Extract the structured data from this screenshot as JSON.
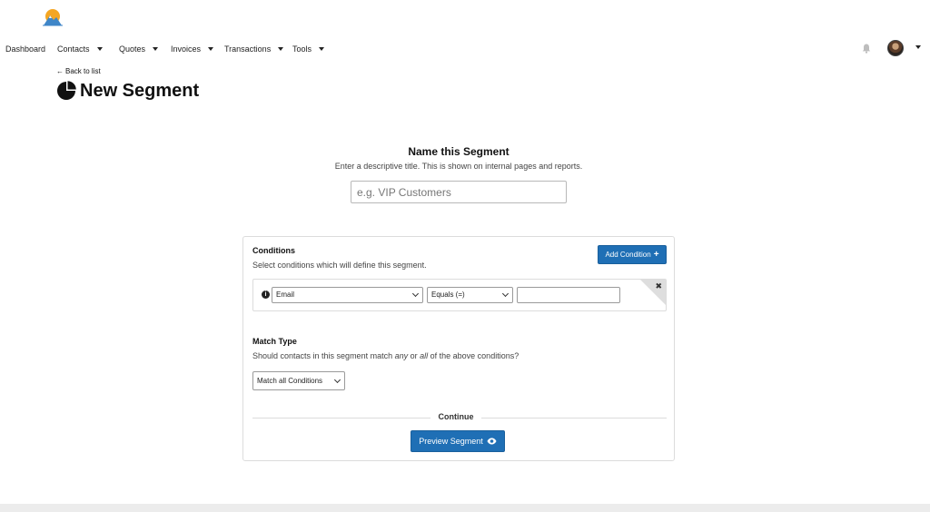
{
  "nav": {
    "items": [
      {
        "label": "Dashboard",
        "dropdown": false
      },
      {
        "label": "Contacts",
        "dropdown": true
      },
      {
        "label": "Quotes",
        "dropdown": true
      },
      {
        "label": "Invoices",
        "dropdown": true
      },
      {
        "label": "Transactions",
        "dropdown": true
      },
      {
        "label": "Tools",
        "dropdown": true
      }
    ]
  },
  "header": {
    "back_label": "Back to list",
    "title": "New Segment",
    "icon": "pie-chart-icon"
  },
  "name_section": {
    "heading": "Name this Segment",
    "subtitle": "Enter a descriptive title. This is shown on internal pages and reports.",
    "placeholder": "e.g. VIP Customers",
    "value": ""
  },
  "conditions": {
    "title": "Conditions",
    "subtitle": "Select conditions which will define this segment.",
    "add_button": "Add Condition",
    "rows": [
      {
        "field": "Email",
        "operator": "Equals (=)",
        "value": ""
      }
    ]
  },
  "match_type": {
    "title": "Match Type",
    "subtitle_before": "Should contacts in this segment match ",
    "subtitle_any": "any",
    "subtitle_mid": " or ",
    "subtitle_all": "all",
    "subtitle_after": " of the above conditions?",
    "selected": "Match all Conditions"
  },
  "footer": {
    "continue_label": "Continue",
    "preview_button": "Preview Segment"
  },
  "colors": {
    "primary": "#1f6fb5",
    "footer_band": "#ececec"
  }
}
